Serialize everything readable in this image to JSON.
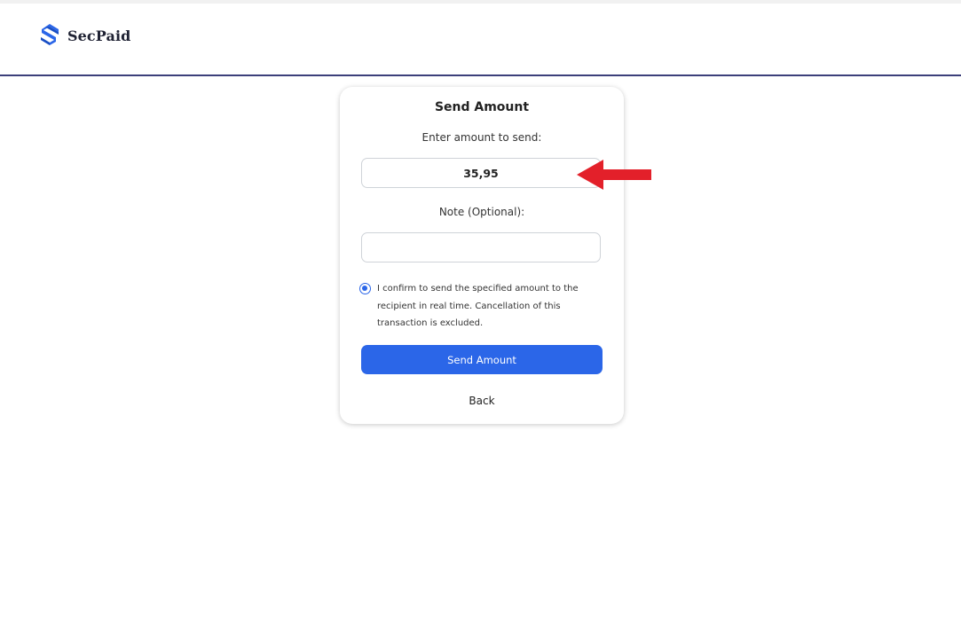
{
  "header": {
    "brand": "SecPaid",
    "logo_icon": "secpaid-s-logo-icon",
    "accent_color": "#2b66e8",
    "rule_color": "#3c3f7a"
  },
  "form": {
    "title": "Send Amount",
    "amount_label": "Enter amount to send:",
    "amount_value": "35,95",
    "note_label": "Note (Optional):",
    "note_value": "",
    "confirm_selected": true,
    "confirm_text": "I confirm to send the specified amount to the recipient in real time. Cancellation of this transaction is excluded.",
    "send_button": "Send Amount",
    "back_link": "Back"
  },
  "annotation": {
    "icon": "red-arrow-icon",
    "color": "#e3202a"
  }
}
